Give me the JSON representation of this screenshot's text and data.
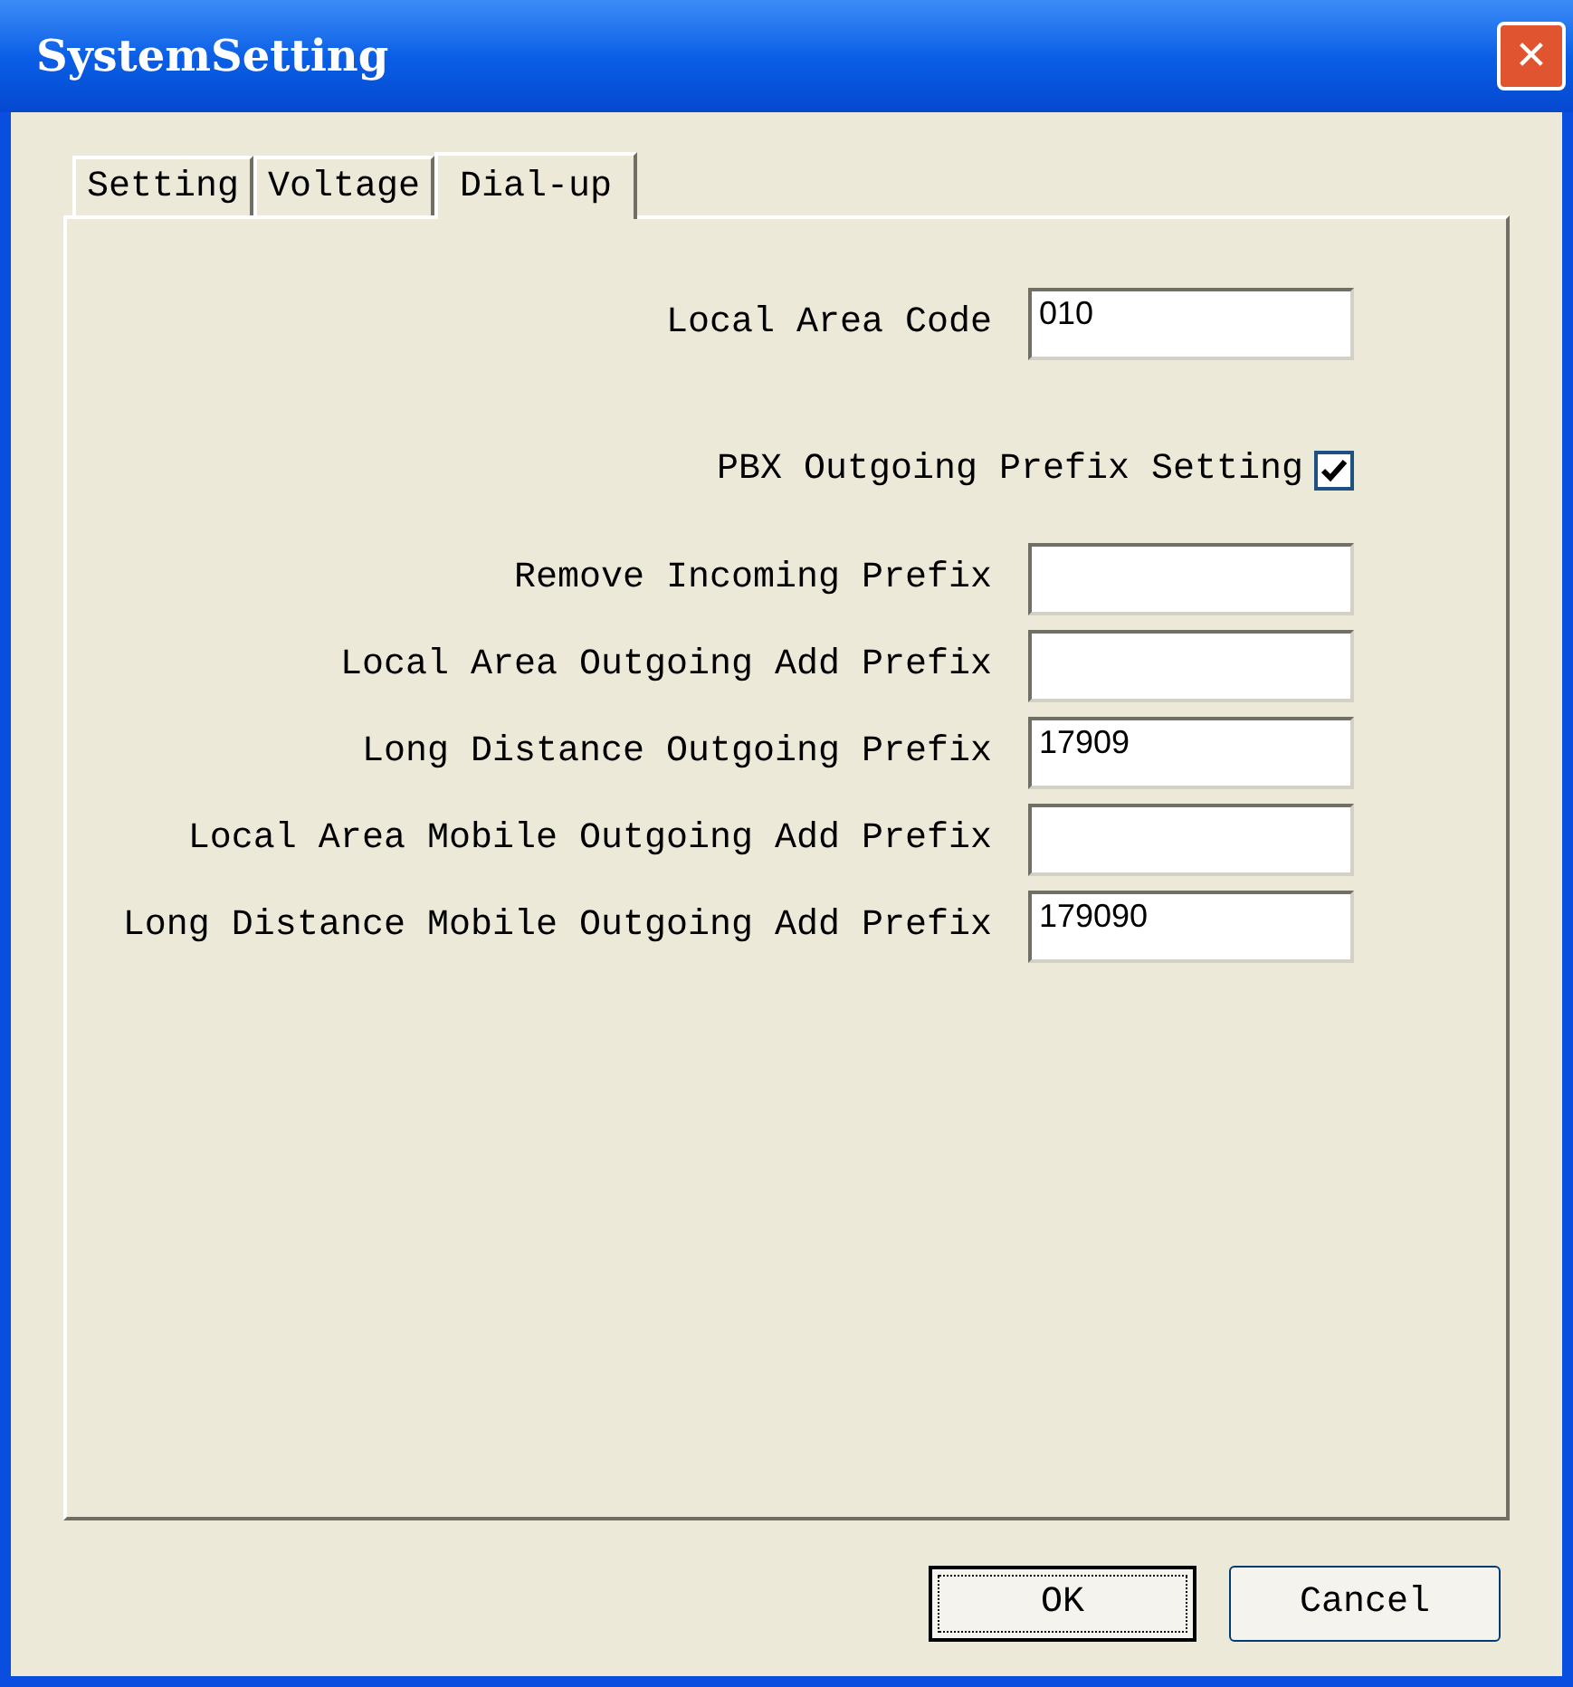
{
  "window": {
    "title": "SystemSetting",
    "close": "✕"
  },
  "tabs": [
    {
      "label": "Setting",
      "selected": false
    },
    {
      "label": "Voltage",
      "selected": false
    },
    {
      "label": "Dial-up",
      "selected": true
    }
  ],
  "fields": [
    {
      "kind": "text",
      "label": "Local Area Code",
      "value": "010"
    },
    {
      "kind": "checkbox",
      "label": "PBX Outgoing Prefix Setting",
      "checked": true
    },
    {
      "kind": "text",
      "label": "Remove Incoming Prefix"
    },
    {
      "kind": "text",
      "label": "Local Area Outgoing Add Prefix"
    },
    {
      "kind": "text",
      "label": "Long Distance Outgoing Prefix",
      "value": "17909"
    },
    {
      "kind": "text",
      "label": "Local Area Mobile Outgoing Add Prefix"
    },
    {
      "kind": "text",
      "label": "Long Distance Mobile Outgoing Add Prefix",
      "value": "179090"
    }
  ],
  "buttons": [
    {
      "label": "OK",
      "focused": true
    },
    {
      "label": "Cancel",
      "focused": false
    }
  ]
}
